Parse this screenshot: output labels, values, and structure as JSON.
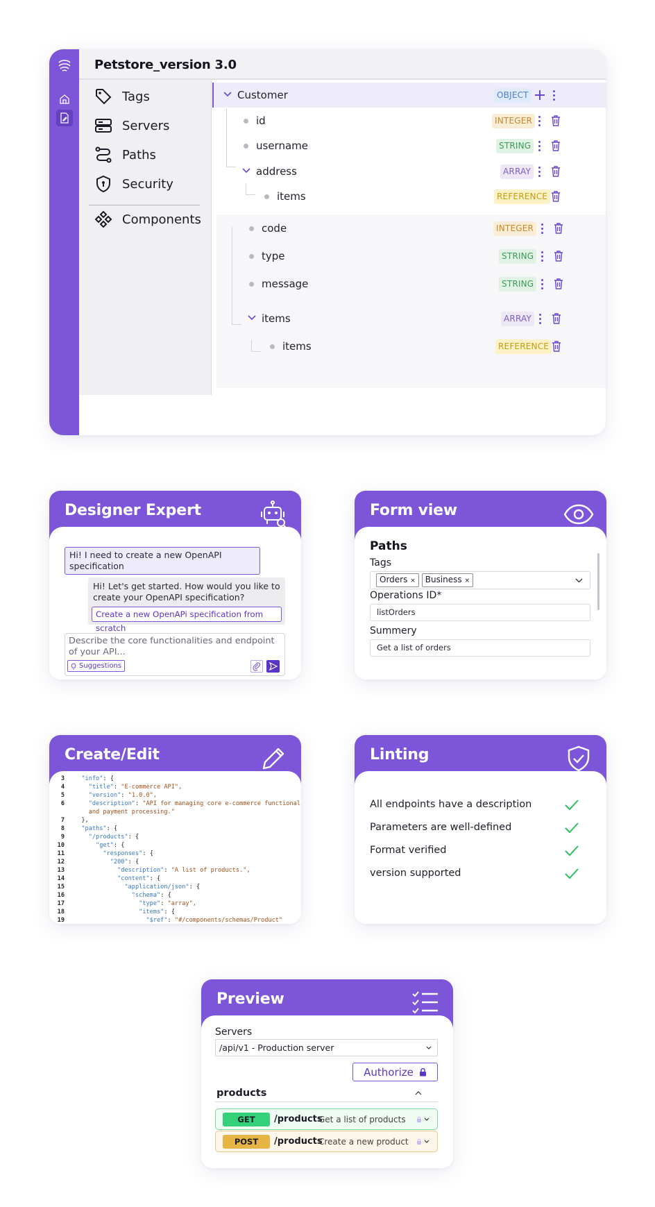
{
  "app": {
    "title": "Petstore_version 3.0",
    "nav": [
      {
        "label": "Tags",
        "icon": "tag-icon"
      },
      {
        "label": "Servers",
        "icon": "server-icon"
      },
      {
        "label": "Paths",
        "icon": "route-icon"
      },
      {
        "label": "Security",
        "icon": "shield-icon"
      },
      {
        "label": "Components",
        "icon": "components-icon"
      }
    ],
    "tree": [
      {
        "label": "Customer",
        "type": "OBJECT"
      },
      {
        "label": "id",
        "type": "INTEGER"
      },
      {
        "label": "username",
        "type": "STRING"
      },
      {
        "label": "address",
        "type": "ARRAY"
      },
      {
        "label": "items",
        "type": "REFERENCE"
      },
      {
        "label": "code",
        "type": "INTEGER"
      },
      {
        "label": "type",
        "type": "STRING"
      },
      {
        "label": "message",
        "type": "STRING"
      },
      {
        "label": "items",
        "type": "ARRAY"
      },
      {
        "label": "items",
        "type": "REFERENCE"
      }
    ]
  },
  "designer": {
    "title": "Designer Expert",
    "user_message": "Hi! I need to create a new OpenAPI specification",
    "bot_message": "Hi! Let's get started. How would you like to create your OpenAPI specification?",
    "option": "Create a new OpenAPi specification from scratch",
    "input_placeholder": "Describe the core functionalities and endpoint of your API...",
    "suggestions": "Suggestions"
  },
  "formview": {
    "title": "Form view",
    "section": "Paths",
    "tags_label": "Tags",
    "tags": [
      "Orders",
      "Business"
    ],
    "opid_label": "Operations ID*",
    "opid_value": "listOrders",
    "summary_label": "Summery",
    "summary_value": "Get a list of orders"
  },
  "editor": {
    "title": "Create/Edit",
    "lines": [
      {
        "n": "3",
        "t": "  \"info\": {"
      },
      {
        "n": "4",
        "t": "    \"title\": \"E-commerce API\","
      },
      {
        "n": "5",
        "t": "    \"version\": \"1.0.0\","
      },
      {
        "n": "6",
        "t": "    \"description\": \"API for managing core e-commerce functionali"
      },
      {
        "n": "",
        "t": "    and payment processing.\""
      },
      {
        "n": "7",
        "t": "  },"
      },
      {
        "n": "8",
        "t": "  \"paths\": {"
      },
      {
        "n": "9",
        "t": "    \"/products\": {"
      },
      {
        "n": "10",
        "t": "      \"get\": {"
      },
      {
        "n": "11",
        "t": "        \"responses\": {"
      },
      {
        "n": "12",
        "t": "          \"200\": {"
      },
      {
        "n": "13",
        "t": "            \"description\": \"A list of products.\","
      },
      {
        "n": "14",
        "t": "            \"content\": {"
      },
      {
        "n": "15",
        "t": "              \"application/json\": {"
      },
      {
        "n": "16",
        "t": "                \"schema\": {"
      },
      {
        "n": "17",
        "t": "                  \"type\": \"array\","
      },
      {
        "n": "18",
        "t": "                  \"items\": {"
      },
      {
        "n": "19",
        "t": "                    \"$ref\": \"#/components/schemas/Product\""
      }
    ]
  },
  "linting": {
    "title": "Linting",
    "checks": [
      "All endpoints have a description",
      "Parameters are well-defined",
      "Format verified",
      "version supported"
    ]
  },
  "preview": {
    "title": "Preview",
    "servers_label": "Servers",
    "server_value": "/api/v1 - Production server",
    "authorize": "Authorize",
    "group": "products",
    "operations": [
      {
        "verb": "GET",
        "path": "/products",
        "desc": "Get a list of products",
        "color": "#34d17a"
      },
      {
        "verb": "POST",
        "path": "/products",
        "desc": "Create a new product",
        "color": "#e6b544"
      }
    ]
  },
  "colors": {
    "accent": "#7c55d8"
  }
}
